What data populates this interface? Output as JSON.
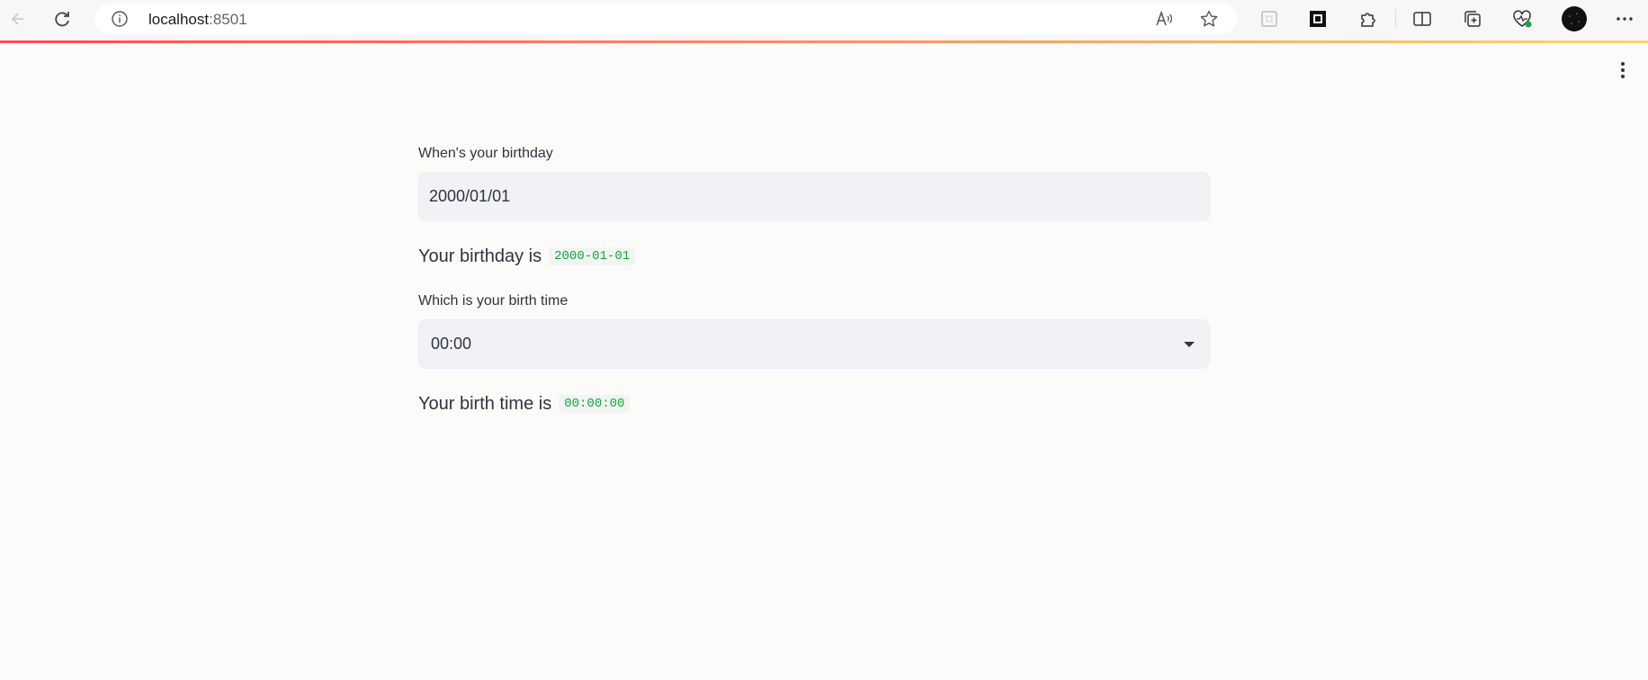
{
  "browser": {
    "url_host": "localhost",
    "url_port": ":8501",
    "colors": {
      "accent_gradient_start": "#ff4b4b",
      "accent_gradient_end": "#ffd36b"
    }
  },
  "app": {
    "date_input": {
      "label": "When's your birthday",
      "value": "2000/01/01"
    },
    "date_result": {
      "prefix": "Your birthday is",
      "value": "2000-01-01"
    },
    "time_select": {
      "label": "Which is your birth time",
      "value": "00:00"
    },
    "time_result": {
      "prefix": "Your birth time is",
      "value": "00:00:00"
    },
    "colors": {
      "input_bg": "#f0f2f6",
      "code_text": "#09ab3b",
      "text": "#31333f"
    }
  }
}
